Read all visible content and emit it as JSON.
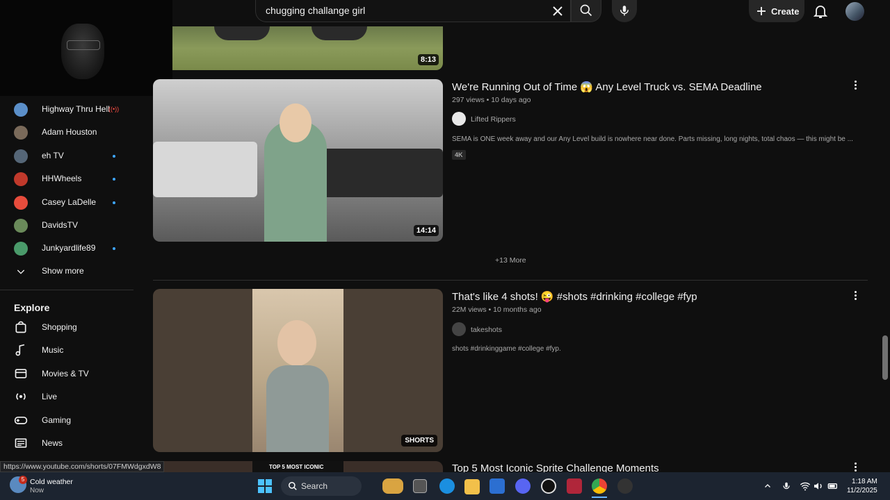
{
  "header": {
    "search_query": "chugging challange girl",
    "create_label": "Create"
  },
  "sidebar": {
    "subscriptions": [
      {
        "label": "Highway Thru Hell",
        "status": "live",
        "avatar_color": "#5b8fc9"
      },
      {
        "label": "Adam Houston",
        "status": "",
        "avatar_color": "#7a6a5a"
      },
      {
        "label": "eh TV",
        "status": "new",
        "avatar_color": "#556677"
      },
      {
        "label": "HHWheels",
        "status": "new",
        "avatar_color": "#c0392b"
      },
      {
        "label": "Casey LaDelle",
        "status": "new",
        "avatar_color": "#e74c3c"
      },
      {
        "label": "DavidsTV",
        "status": "",
        "avatar_color": "#6a8a5a"
      },
      {
        "label": "Junkyardlife89",
        "status": "new",
        "avatar_color": "#4a9a6a"
      }
    ],
    "show_more": "Show more",
    "explore_title": "Explore",
    "explore": [
      {
        "label": "Shopping",
        "icon": "shopping-bag-icon"
      },
      {
        "label": "Music",
        "icon": "music-note-icon"
      },
      {
        "label": "Movies & TV",
        "icon": "film-icon"
      },
      {
        "label": "Live",
        "icon": "live-broadcast-icon"
      },
      {
        "label": "Gaming",
        "icon": "gamepad-icon"
      },
      {
        "label": "News",
        "icon": "newspaper-icon"
      }
    ]
  },
  "results": {
    "partial_top": {
      "duration": "8:13"
    },
    "video1": {
      "title": "We're Running Out of Time 😱 Any Level Truck vs. SEMA Deadline",
      "meta": "297 views • 10 days ago",
      "channel": "Lifted Rippers",
      "description": "SEMA is ONE week away and our Any Level build is nowhere near done. Parts missing, long nights, total chaos — this might be ...",
      "badge": "4K",
      "duration": "14:14"
    },
    "more_label": "+13 More",
    "video2": {
      "title": "That's like 4 shots! 😜 #shots #drinking #college #fyp",
      "meta": "22M views • 10 months ago",
      "channel": "takeshots",
      "description": "shots #drinkinggame #college #fyp.",
      "badge": "SHORTS"
    },
    "video3": {
      "title": "Top 5 Most Iconic Sprite Challenge Moments",
      "thumb_text": "TOP 5 MOST ICONIC"
    }
  },
  "status_url": "https://www.youtube.com/shorts/07FMWdgxdW8",
  "taskbar": {
    "weather_title": "Cold weather",
    "weather_sub": "Now",
    "weather_badge": "5",
    "search_label": "Search",
    "time": "1:18 AM",
    "date": "11/2/2025"
  }
}
